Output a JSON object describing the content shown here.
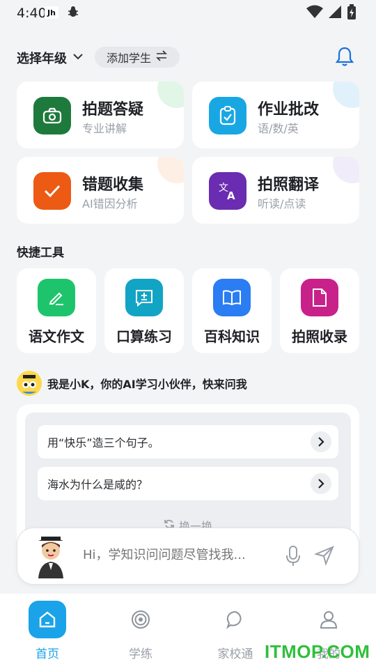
{
  "status_bar": {
    "time": "4:40",
    "app_icon_text": "Jh"
  },
  "header": {
    "grade_select_label": "选择年级",
    "add_student_label": "添加学生",
    "icons": [
      "chevron-down-icon",
      "swap-icon",
      "bell-icon"
    ]
  },
  "feature_cards": [
    {
      "title": "拍题答疑",
      "subtitle": "专业讲解",
      "icon": "camera-icon",
      "color": "#1e7a3c",
      "corner": "#c8efd2"
    },
    {
      "title": "作业批改",
      "subtitle": "语/数/英",
      "icon": "clipboard-check-icon",
      "color": "#19a7e4",
      "corner": "#c9e6f7"
    },
    {
      "title": "错题收集",
      "subtitle": "AI错因分析",
      "icon": "check-icon",
      "color": "#ec5a14",
      "corner": "#fde2cf"
    },
    {
      "title": "拍照翻译",
      "subtitle": "听读/点读",
      "icon": "translate-icon",
      "color": "#6a2cb0",
      "corner": "#e6dcf6"
    }
  ],
  "quick_tools": {
    "title": "快捷工具",
    "items": [
      {
        "label": "语文作文",
        "icon": "pencil-icon",
        "color": "#1ec46c"
      },
      {
        "label": "口算练习",
        "icon": "calculator-chat-icon",
        "color": "#12a4c4"
      },
      {
        "label": "百科知识",
        "icon": "book-icon",
        "color": "#2a7df2"
      },
      {
        "label": "拍照收录",
        "icon": "document-icon",
        "color": "#c8228a"
      }
    ]
  },
  "assistant": {
    "intro": "我是小K，你的AI学习小伙伴，快来问我",
    "questions": [
      "用“快乐”造三个句子。",
      "海水为什么是咸的？"
    ],
    "refresh_label": "换一换"
  },
  "chat": {
    "placeholder": "Hi，学知识问问题尽管找我..."
  },
  "tabs": [
    {
      "label": "首页",
      "icon": "home-icon",
      "active": true
    },
    {
      "label": "学练",
      "icon": "target-icon",
      "active": false
    },
    {
      "label": "家校通",
      "icon": "chat-bubble-icon",
      "active": false
    },
    {
      "label": "我的",
      "icon": "person-icon",
      "active": false
    }
  ],
  "watermark": "ITMOP.COM"
}
